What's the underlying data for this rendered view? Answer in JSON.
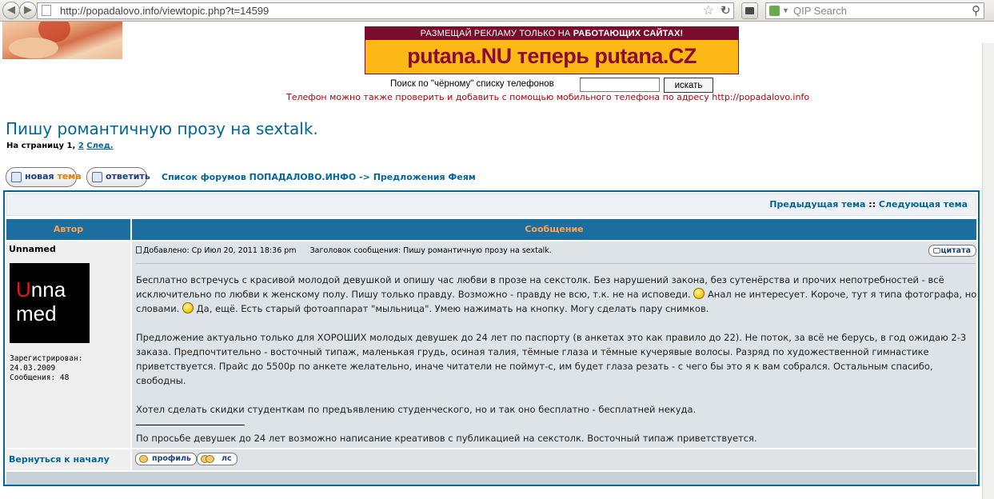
{
  "browser": {
    "url": "http://popadalovo.info/viewtopic.php?t=14599",
    "search_placeholder": "QIP Search"
  },
  "banner": {
    "top_text": "РАЗМЕЩАЙ РЕКЛАМУ ТОЛЬКО НА ",
    "top_highlight": "РАБОТАЮЩИХ САЙТАХ!",
    "main_text": "putana.NU теперь putana.CZ"
  },
  "phone_search": {
    "label": "Поиск по \"чёрному\" списку телефонов",
    "input_value": "",
    "button_label": "искать",
    "note": "Телефон можно также проверить и добавить с помощью мобильного телефона по адресу http://popadalovo.info"
  },
  "topic": {
    "title": "Пишу романтичную прозу на sextalk.",
    "pagination_prefix": "На страницу 1,",
    "page_2": "2",
    "next": "След."
  },
  "actions": {
    "new_topic_a": "новая",
    "new_topic_b": "тема",
    "reply": "ответить"
  },
  "breadcrumb": "Список форумов ПОПАДАЛОВО.ИНФО -> Предложения Феям",
  "topic_nav": {
    "prev": "Предыдущая тема",
    "sep": " :: ",
    "next": "Следующая тема"
  },
  "table": {
    "col_author": "Автор",
    "col_message": "Сообщение"
  },
  "post": {
    "author": "Unnamed",
    "avatar_line1_first": "U",
    "avatar_line1_rest": "nna",
    "avatar_line2": "med",
    "registered_label": "Зарегистрирован:",
    "registered_date": "24.03.2009",
    "messages_label": "Сообщения: 48",
    "added": "Добавлено: Ср Июл 20, 2011 18:36 pm",
    "subject": "Заголовок сообщения: Пишу романтичную прозу на sextalk.",
    "quote_button": "цитата",
    "p1_a": "Бесплатно встречусь с красивой молодой девушкой и опишу час любви в прозе на секстолк. Без нарушений закона, без сутенёрства и прочих непотребностей - всё исключительно по любви к женскому полу. Пишу только правду. Возможно - правду не всю, т.к. не на исповеди.",
    "p1_b": "Анал не интересует. Короче, тут я типа фотографа, но словами.",
    "p1_c": "Да, ещё. Есть старый фотоаппарат \"мыльница\". Умею нажимать на кнопку. Могу сделать пару снимков.",
    "p2": "Предложение актуально только для ХОРОШИХ молодых девушек до 24 лет по паспорту (в анкетах это как правило до 22). Не поток, за всё не берусь, в год ожидаю 2-3 заказа. Предпочтительно - восточный типаж, маленькая грудь, осиная талия, тёмные глаза и тёмные кучерявые волосы. Разряд по художественной гимнастике приветствуется. Прайс до 5500р по анкете желательно, иначе читатели не поймут-с, им будет глаза резать - с чего бы это я к вам собрался. Остальным спасибо, свободны.",
    "p3": "Хотел сделать скидки студенткам по предъявлению студенческого, но и так оно бесплатно - бесплатней некуда.",
    "signature": "По просьбе девушек до 24 лет возможно написание креативов с публикацией на секстолк. Восточный типаж приветствуется."
  },
  "post_footer": {
    "back_to_top": "Вернуться к началу",
    "profile": "профиль",
    "pm": "лс"
  },
  "colors": {
    "link": "#006699",
    "header_bg": "#1c6ea0",
    "header_text": "#ffa34f",
    "note_red": "#b3000b"
  }
}
